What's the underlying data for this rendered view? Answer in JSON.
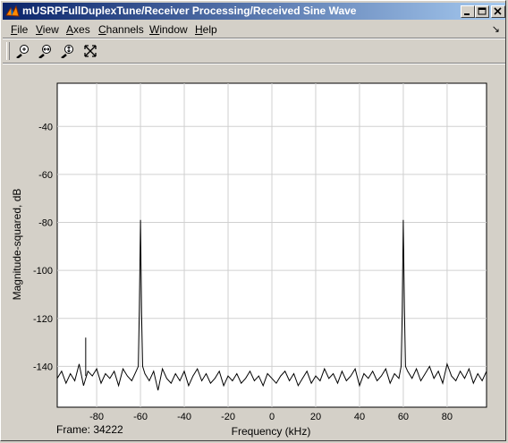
{
  "window": {
    "title": "mUSRPFullDuplexTune/Receiver Processing/Received Sine Wave"
  },
  "menu": {
    "items": [
      {
        "u": "F",
        "rest": "ile"
      },
      {
        "u": "V",
        "rest": "iew"
      },
      {
        "u": "A",
        "rest": "xes"
      },
      {
        "u": "C",
        "rest": "hannels"
      },
      {
        "u": "W",
        "rest": "indow"
      },
      {
        "u": "H",
        "rest": "elp"
      }
    ],
    "arrow": "↘"
  },
  "toolbar": {
    "tools": [
      "zoom-in-icon",
      "zoom-x-icon",
      "zoom-y-icon",
      "autoscale-icon"
    ]
  },
  "status": {
    "frame": "Frame: 34222"
  },
  "chart_data": {
    "type": "line",
    "xlabel": "Frequency (kHz)",
    "ylabel": "Magnitude-squared, dB",
    "xlim": [
      -98,
      98
    ],
    "ylim": [
      -157,
      -136.5
    ],
    "ylim_full": [
      -157,
      -22
    ],
    "xticks": [
      -80,
      -60,
      -40,
      -20,
      0,
      20,
      40,
      60,
      80
    ],
    "yticks": [
      -40,
      -60,
      -80,
      -100,
      -120,
      -140
    ],
    "grid": true,
    "series": [
      {
        "color": "#000000",
        "noise_floor_db": -144,
        "x": [
          -98,
          -96,
          -94,
          -92,
          -90,
          -88,
          -86,
          -84,
          -82,
          -80,
          -78,
          -76,
          -74,
          -72,
          -70,
          -68,
          -66,
          -64,
          -62,
          -61,
          -60.5,
          -60,
          -59.5,
          -59,
          -58,
          -56,
          -54,
          -52,
          -50,
          -48,
          -46,
          -44,
          -42,
          -40,
          -38,
          -36,
          -34,
          -32,
          -30,
          -28,
          -26,
          -24,
          -22,
          -20,
          -18,
          -16,
          -14,
          -12,
          -10,
          -8,
          -6,
          -4,
          -2,
          0,
          2,
          4,
          6,
          8,
          10,
          12,
          14,
          16,
          18,
          20,
          22,
          24,
          26,
          28,
          30,
          32,
          34,
          36,
          38,
          40,
          42,
          44,
          46,
          48,
          50,
          52,
          54,
          56,
          58,
          59,
          59.5,
          60,
          60.5,
          61,
          62,
          64,
          66,
          68,
          70,
          72,
          74,
          76,
          78,
          80,
          82,
          84,
          86,
          88,
          90,
          92,
          94,
          96,
          98
        ],
        "y": [
          -145,
          -142,
          -147,
          -143,
          -146,
          -139,
          -148,
          -142,
          -144,
          -141,
          -147,
          -143,
          -145,
          -142,
          -148,
          -141,
          -144,
          -146,
          -142,
          -140,
          -116,
          -79,
          -118,
          -140,
          -143,
          -146,
          -142,
          -150,
          -141,
          -145,
          -147,
          -143,
          -146,
          -142,
          -148,
          -144,
          -141,
          -146,
          -143,
          -147,
          -145,
          -142,
          -148,
          -144,
          -146,
          -143,
          -147,
          -145,
          -142,
          -146,
          -144,
          -148,
          -143,
          -145,
          -147,
          -144,
          -142,
          -146,
          -143,
          -148,
          -145,
          -142,
          -147,
          -144,
          -146,
          -141,
          -145,
          -143,
          -147,
          -142,
          -146,
          -144,
          -141,
          -148,
          -143,
          -145,
          -142,
          -146,
          -144,
          -141,
          -147,
          -143,
          -145,
          -140,
          -118,
          -79,
          -116,
          -140,
          -142,
          -145,
          -141,
          -146,
          -143,
          -140,
          -145,
          -142,
          -147,
          -139,
          -144,
          -146,
          -142,
          -145,
          -141,
          -147,
          -143,
          -146,
          -142
        ]
      }
    ],
    "spike": {
      "x": -85,
      "y": -128
    }
  }
}
